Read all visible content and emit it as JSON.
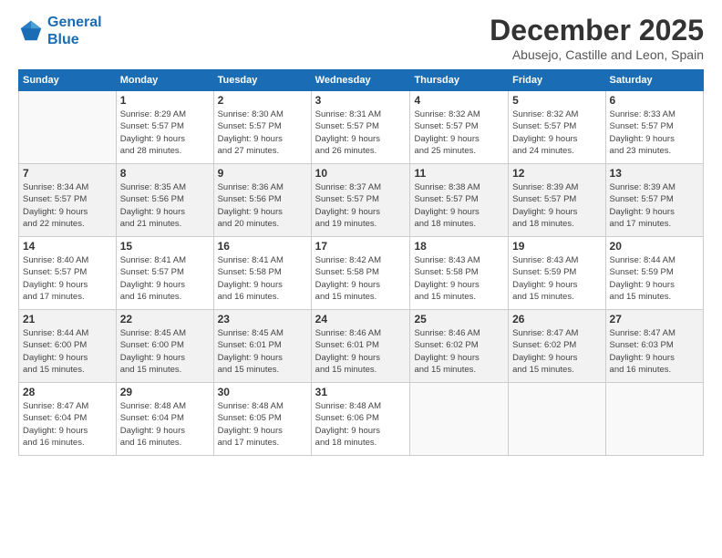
{
  "logo": {
    "line1": "General",
    "line2": "Blue"
  },
  "title": "December 2025",
  "subtitle": "Abusejo, Castille and Leon, Spain",
  "weekdays": [
    "Sunday",
    "Monday",
    "Tuesday",
    "Wednesday",
    "Thursday",
    "Friday",
    "Saturday"
  ],
  "weeks": [
    [
      {
        "day": "",
        "info": ""
      },
      {
        "day": "1",
        "info": "Sunrise: 8:29 AM\nSunset: 5:57 PM\nDaylight: 9 hours\nand 28 minutes."
      },
      {
        "day": "2",
        "info": "Sunrise: 8:30 AM\nSunset: 5:57 PM\nDaylight: 9 hours\nand 27 minutes."
      },
      {
        "day": "3",
        "info": "Sunrise: 8:31 AM\nSunset: 5:57 PM\nDaylight: 9 hours\nand 26 minutes."
      },
      {
        "day": "4",
        "info": "Sunrise: 8:32 AM\nSunset: 5:57 PM\nDaylight: 9 hours\nand 25 minutes."
      },
      {
        "day": "5",
        "info": "Sunrise: 8:32 AM\nSunset: 5:57 PM\nDaylight: 9 hours\nand 24 minutes."
      },
      {
        "day": "6",
        "info": "Sunrise: 8:33 AM\nSunset: 5:57 PM\nDaylight: 9 hours\nand 23 minutes."
      }
    ],
    [
      {
        "day": "7",
        "info": "Sunrise: 8:34 AM\nSunset: 5:57 PM\nDaylight: 9 hours\nand 22 minutes."
      },
      {
        "day": "8",
        "info": "Sunrise: 8:35 AM\nSunset: 5:56 PM\nDaylight: 9 hours\nand 21 minutes."
      },
      {
        "day": "9",
        "info": "Sunrise: 8:36 AM\nSunset: 5:56 PM\nDaylight: 9 hours\nand 20 minutes."
      },
      {
        "day": "10",
        "info": "Sunrise: 8:37 AM\nSunset: 5:57 PM\nDaylight: 9 hours\nand 19 minutes."
      },
      {
        "day": "11",
        "info": "Sunrise: 8:38 AM\nSunset: 5:57 PM\nDaylight: 9 hours\nand 18 minutes."
      },
      {
        "day": "12",
        "info": "Sunrise: 8:39 AM\nSunset: 5:57 PM\nDaylight: 9 hours\nand 18 minutes."
      },
      {
        "day": "13",
        "info": "Sunrise: 8:39 AM\nSunset: 5:57 PM\nDaylight: 9 hours\nand 17 minutes."
      }
    ],
    [
      {
        "day": "14",
        "info": "Sunrise: 8:40 AM\nSunset: 5:57 PM\nDaylight: 9 hours\nand 17 minutes."
      },
      {
        "day": "15",
        "info": "Sunrise: 8:41 AM\nSunset: 5:57 PM\nDaylight: 9 hours\nand 16 minutes."
      },
      {
        "day": "16",
        "info": "Sunrise: 8:41 AM\nSunset: 5:58 PM\nDaylight: 9 hours\nand 16 minutes."
      },
      {
        "day": "17",
        "info": "Sunrise: 8:42 AM\nSunset: 5:58 PM\nDaylight: 9 hours\nand 15 minutes."
      },
      {
        "day": "18",
        "info": "Sunrise: 8:43 AM\nSunset: 5:58 PM\nDaylight: 9 hours\nand 15 minutes."
      },
      {
        "day": "19",
        "info": "Sunrise: 8:43 AM\nSunset: 5:59 PM\nDaylight: 9 hours\nand 15 minutes."
      },
      {
        "day": "20",
        "info": "Sunrise: 8:44 AM\nSunset: 5:59 PM\nDaylight: 9 hours\nand 15 minutes."
      }
    ],
    [
      {
        "day": "21",
        "info": "Sunrise: 8:44 AM\nSunset: 6:00 PM\nDaylight: 9 hours\nand 15 minutes."
      },
      {
        "day": "22",
        "info": "Sunrise: 8:45 AM\nSunset: 6:00 PM\nDaylight: 9 hours\nand 15 minutes."
      },
      {
        "day": "23",
        "info": "Sunrise: 8:45 AM\nSunset: 6:01 PM\nDaylight: 9 hours\nand 15 minutes."
      },
      {
        "day": "24",
        "info": "Sunrise: 8:46 AM\nSunset: 6:01 PM\nDaylight: 9 hours\nand 15 minutes."
      },
      {
        "day": "25",
        "info": "Sunrise: 8:46 AM\nSunset: 6:02 PM\nDaylight: 9 hours\nand 15 minutes."
      },
      {
        "day": "26",
        "info": "Sunrise: 8:47 AM\nSunset: 6:02 PM\nDaylight: 9 hours\nand 15 minutes."
      },
      {
        "day": "27",
        "info": "Sunrise: 8:47 AM\nSunset: 6:03 PM\nDaylight: 9 hours\nand 16 minutes."
      }
    ],
    [
      {
        "day": "28",
        "info": "Sunrise: 8:47 AM\nSunset: 6:04 PM\nDaylight: 9 hours\nand 16 minutes."
      },
      {
        "day": "29",
        "info": "Sunrise: 8:48 AM\nSunset: 6:04 PM\nDaylight: 9 hours\nand 16 minutes."
      },
      {
        "day": "30",
        "info": "Sunrise: 8:48 AM\nSunset: 6:05 PM\nDaylight: 9 hours\nand 17 minutes."
      },
      {
        "day": "31",
        "info": "Sunrise: 8:48 AM\nSunset: 6:06 PM\nDaylight: 9 hours\nand 18 minutes."
      },
      {
        "day": "",
        "info": ""
      },
      {
        "day": "",
        "info": ""
      },
      {
        "day": "",
        "info": ""
      }
    ]
  ]
}
